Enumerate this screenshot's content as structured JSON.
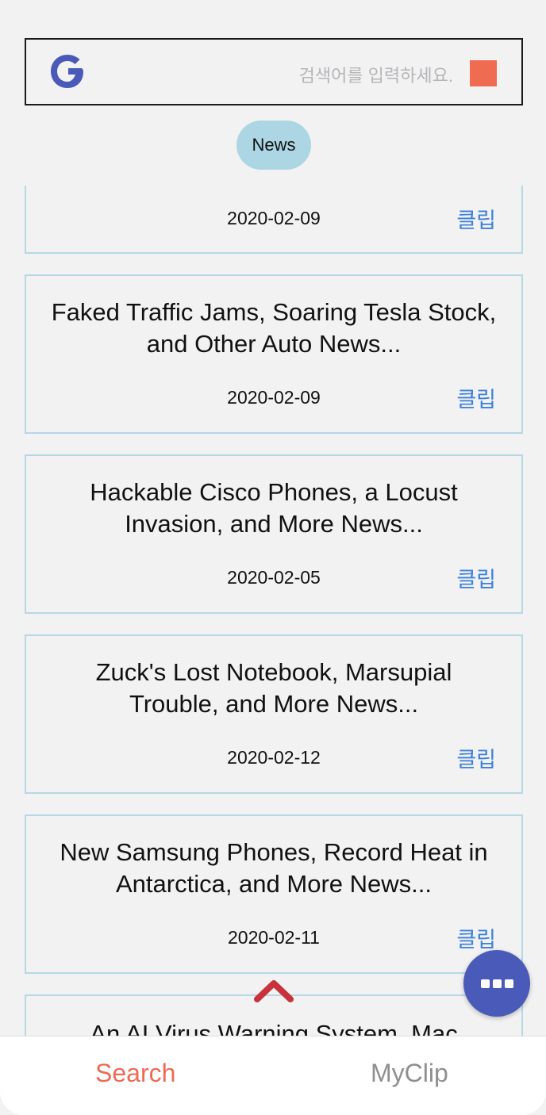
{
  "search": {
    "placeholder": "검색어를 입력하세요.",
    "logo_letter": "G",
    "submit_color": "#ef6b52"
  },
  "category": {
    "label": "News"
  },
  "articles": [
    {
      "title": "",
      "date": "2020-02-09",
      "clip_label": "클립"
    },
    {
      "title": "Faked Traffic Jams, Soaring Tesla Stock, and Other Auto News...",
      "date": "2020-02-09",
      "clip_label": "클립"
    },
    {
      "title": "Hackable Cisco Phones, a Locust Invasion, and More News...",
      "date": "2020-02-05",
      "clip_label": "클립"
    },
    {
      "title": "Zuck's Lost Notebook, Marsupial Trouble, and More News...",
      "date": "2020-02-12",
      "clip_label": "클립"
    },
    {
      "title": "New Samsung Phones, Record Heat in Antarctica, and More News...",
      "date": "2020-02-11",
      "clip_label": "클립"
    },
    {
      "title": "An AI Virus Warning System, Mac",
      "date": "",
      "clip_label": ""
    }
  ],
  "icons": {
    "scroll_top": "chevron-up-icon",
    "fab": "more-icon"
  },
  "tabs": [
    {
      "label": "Search",
      "active": true
    },
    {
      "label": "MyClip",
      "active": false
    }
  ],
  "colors": {
    "accent": "#ec6b55",
    "link": "#3c80d8",
    "fab": "#4a5ab8",
    "chip": "#acd6e3",
    "card_border": "#b6d8e4",
    "chevron": "#c8323a"
  }
}
